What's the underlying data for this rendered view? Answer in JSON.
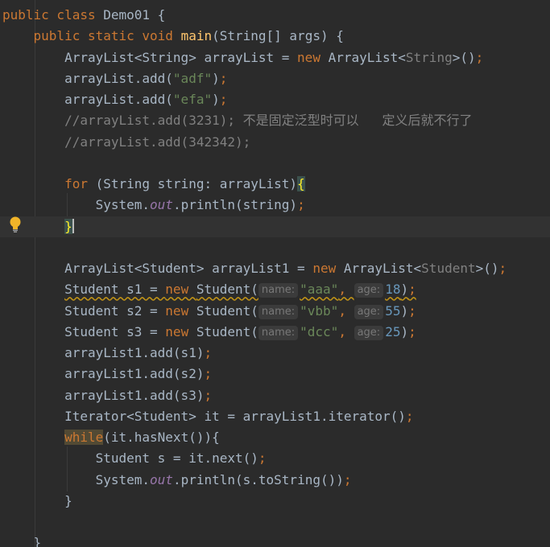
{
  "editor": {
    "lines": [
      {
        "parts": [
          [
            "kw",
            "public class "
          ],
          [
            "pl",
            "Demo01 {"
          ]
        ]
      },
      {
        "parts": [
          [
            "pl",
            "    "
          ],
          [
            "kw",
            "public static void "
          ],
          [
            "fn",
            "main"
          ],
          [
            "pl",
            "(String[] args) {"
          ]
        ]
      },
      {
        "parts": [
          [
            "pl",
            "        ArrayList<String> arrayList = "
          ],
          [
            "kw",
            "new "
          ],
          [
            "pl",
            "ArrayList<"
          ],
          [
            "cmt",
            "String"
          ],
          [
            "pl",
            ">()"
          ],
          [
            "kw",
            ";"
          ]
        ]
      },
      {
        "parts": [
          [
            "pl",
            "        arrayList.add("
          ],
          [
            "str",
            "\"adf\""
          ],
          [
            "pl",
            ")"
          ],
          [
            "kw",
            ";"
          ]
        ]
      },
      {
        "parts": [
          [
            "pl",
            "        arrayList.add("
          ],
          [
            "str",
            "\"efa\""
          ],
          [
            "pl",
            ")"
          ],
          [
            "kw",
            ";"
          ]
        ]
      },
      {
        "parts": [
          [
            "cmt",
            "        //arrayList.add(3231); 不是固定泛型时可以   定义后就不行了"
          ]
        ]
      },
      {
        "parts": [
          [
            "cmt",
            "        //arrayList.add(342342);"
          ]
        ]
      },
      {
        "parts": []
      },
      {
        "parts": [
          [
            "pl",
            "        "
          ],
          [
            "kw",
            "for "
          ],
          [
            "pl",
            "(String string: arrayList)"
          ],
          [
            "brace",
            "{"
          ]
        ]
      },
      {
        "parts": [
          [
            "pl",
            "            System."
          ],
          [
            "field",
            "out"
          ],
          [
            "pl",
            ".println(string)"
          ],
          [
            "kw",
            ";"
          ]
        ]
      },
      {
        "parts": [
          [
            "pl",
            "        "
          ],
          [
            "brace",
            "}"
          ]
        ],
        "current": true,
        "caret": true
      },
      {
        "parts": []
      },
      {
        "parts": [
          [
            "pl",
            "        ArrayList<Student> arrayList1 = "
          ],
          [
            "kw",
            "new "
          ],
          [
            "pl",
            "ArrayList<"
          ],
          [
            "cmt",
            "Student"
          ],
          [
            "pl",
            ">()"
          ],
          [
            "kw",
            ";"
          ]
        ]
      },
      {
        "warn": true,
        "parts": [
          [
            "pl",
            "        "
          ],
          [
            "warn",
            "Student s1 = "
          ],
          [
            "warnkw",
            "new "
          ],
          [
            "warn",
            "Student("
          ],
          [
            "hint",
            "name:"
          ],
          [
            "warnstr",
            "\"aaa\""
          ],
          [
            "warnkw",
            ", "
          ],
          [
            "hint",
            "age:"
          ],
          [
            "warnnum",
            "18"
          ],
          [
            "warn",
            ")"
          ],
          [
            "warnkw",
            ";"
          ]
        ]
      },
      {
        "parts": [
          [
            "pl",
            "        Student s2 = "
          ],
          [
            "kw",
            "new "
          ],
          [
            "pl",
            "Student("
          ],
          [
            "hint",
            "name:"
          ],
          [
            "str",
            "\"vbb\""
          ],
          [
            "kw",
            ", "
          ],
          [
            "hint",
            "age:"
          ],
          [
            "num",
            "55"
          ],
          [
            "pl",
            ")"
          ],
          [
            "kw",
            ";"
          ]
        ]
      },
      {
        "parts": [
          [
            "pl",
            "        Student s3 = "
          ],
          [
            "kw",
            "new "
          ],
          [
            "pl",
            "Student("
          ],
          [
            "hint",
            "name:"
          ],
          [
            "str",
            "\"dcc\""
          ],
          [
            "kw",
            ", "
          ],
          [
            "hint",
            "age:"
          ],
          [
            "num",
            "25"
          ],
          [
            "pl",
            ")"
          ],
          [
            "kw",
            ";"
          ]
        ]
      },
      {
        "parts": [
          [
            "pl",
            "        arrayList1.add(s1)"
          ],
          [
            "kw",
            ";"
          ]
        ]
      },
      {
        "parts": [
          [
            "pl",
            "        arrayList1.add(s2)"
          ],
          [
            "kw",
            ";"
          ]
        ]
      },
      {
        "parts": [
          [
            "pl",
            "        arrayList1.add(s3)"
          ],
          [
            "kw",
            ";"
          ]
        ]
      },
      {
        "parts": [
          [
            "pl",
            "        Iterator<Student> it = arrayList1.iterator()"
          ],
          [
            "kw",
            ";"
          ]
        ]
      },
      {
        "parts": [
          [
            "pl",
            "        "
          ],
          [
            "kwhl",
            "while"
          ],
          [
            "pl",
            "(it.hasNext()){"
          ]
        ]
      },
      {
        "parts": [
          [
            "pl",
            "            Student s = it.next()"
          ],
          [
            "kw",
            ";"
          ]
        ]
      },
      {
        "parts": [
          [
            "pl",
            "            System."
          ],
          [
            "field",
            "out"
          ],
          [
            "pl",
            ".println(s.toString())"
          ],
          [
            "kw",
            ";"
          ]
        ]
      },
      {
        "parts": [
          [
            "pl",
            "        }"
          ]
        ]
      },
      {
        "parts": []
      },
      {
        "parts": [
          [
            "pl",
            "    }"
          ]
        ]
      }
    ]
  },
  "gutter": {
    "intention_icon": "lightbulb-icon"
  },
  "colors": {
    "background": "#2b2b2b",
    "plain": "#a9b7c6",
    "keyword": "#cc7832",
    "function": "#ffc66d",
    "string": "#6a8759",
    "number": "#6897bb",
    "comment": "#808080",
    "field": "#9876aa"
  }
}
